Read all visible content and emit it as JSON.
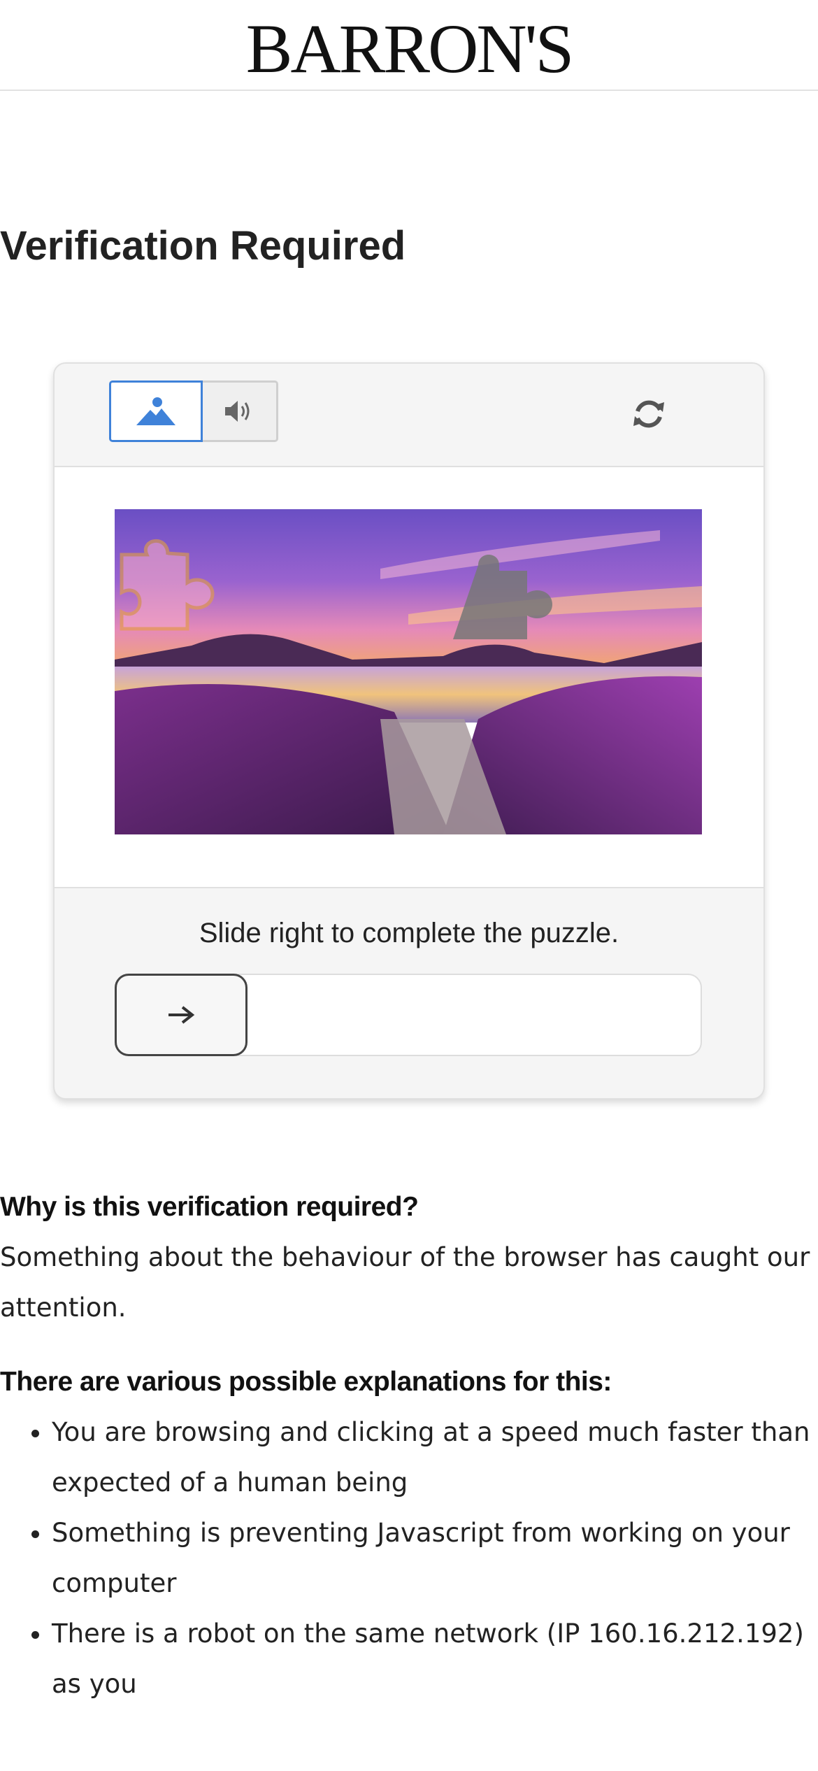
{
  "header": {
    "logo_text": "BARRON'S"
  },
  "page": {
    "title": "Verification Required"
  },
  "captcha": {
    "image_mode_icon": "image-icon",
    "audio_mode_icon": "speaker-icon",
    "refresh_icon": "refresh-icon",
    "instruction": "Slide right to complete the puzzle.",
    "slider_icon": "arrow-right-icon",
    "slider_progress": 0,
    "accent_color": "#3f82d9"
  },
  "info": {
    "why_heading": "Why is this verification required?",
    "why_text": "Something about the behaviour of the browser has caught our attention.",
    "explanations_heading": "There are various possible explanations for this:",
    "reasons": [
      "You are browsing and clicking at a speed much faster than expected of a human being",
      "Something is preventing Javascript from working on your computer",
      "There is a robot on the same network (IP 160.16.212.192) as you"
    ]
  }
}
